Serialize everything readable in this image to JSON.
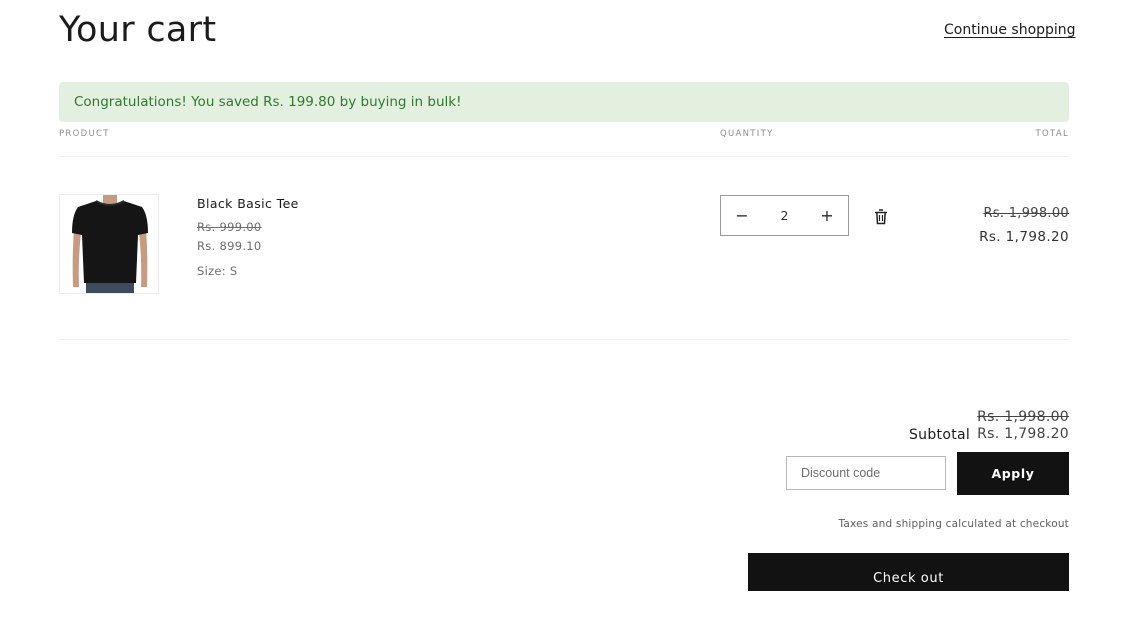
{
  "header": {
    "title": "Your cart",
    "continue_label": "Continue shopping"
  },
  "banner": {
    "text": "Congratulations! You saved Rs. 199.80 by buying in bulk!",
    "color": "#2f7a30",
    "background": "#e3f0df"
  },
  "columns": {
    "product": "PRODUCT",
    "quantity": "QUANTITY",
    "total": "TOTAL"
  },
  "item": {
    "name": "Black Basic Tee",
    "original_price": "Rs. 999.00",
    "price": "Rs. 899.10",
    "size": "Size: S",
    "quantity": "2",
    "total_original": "Rs. 1,998.00",
    "total": "Rs. 1,798.20",
    "image_icon": "black-tshirt-product-image"
  },
  "summary": {
    "subtotal_original": "Rs. 1,998.00",
    "subtotal_label": "Subtotal",
    "subtotal": "Rs. 1,798.20",
    "discount_placeholder": "Discount code",
    "apply_label": "Apply",
    "taxes_note": "Taxes and shipping calculated at checkout",
    "checkout_label": "Check out"
  },
  "colors": {
    "button_bg": "#121212",
    "accent_text": "#1b1b1b"
  }
}
